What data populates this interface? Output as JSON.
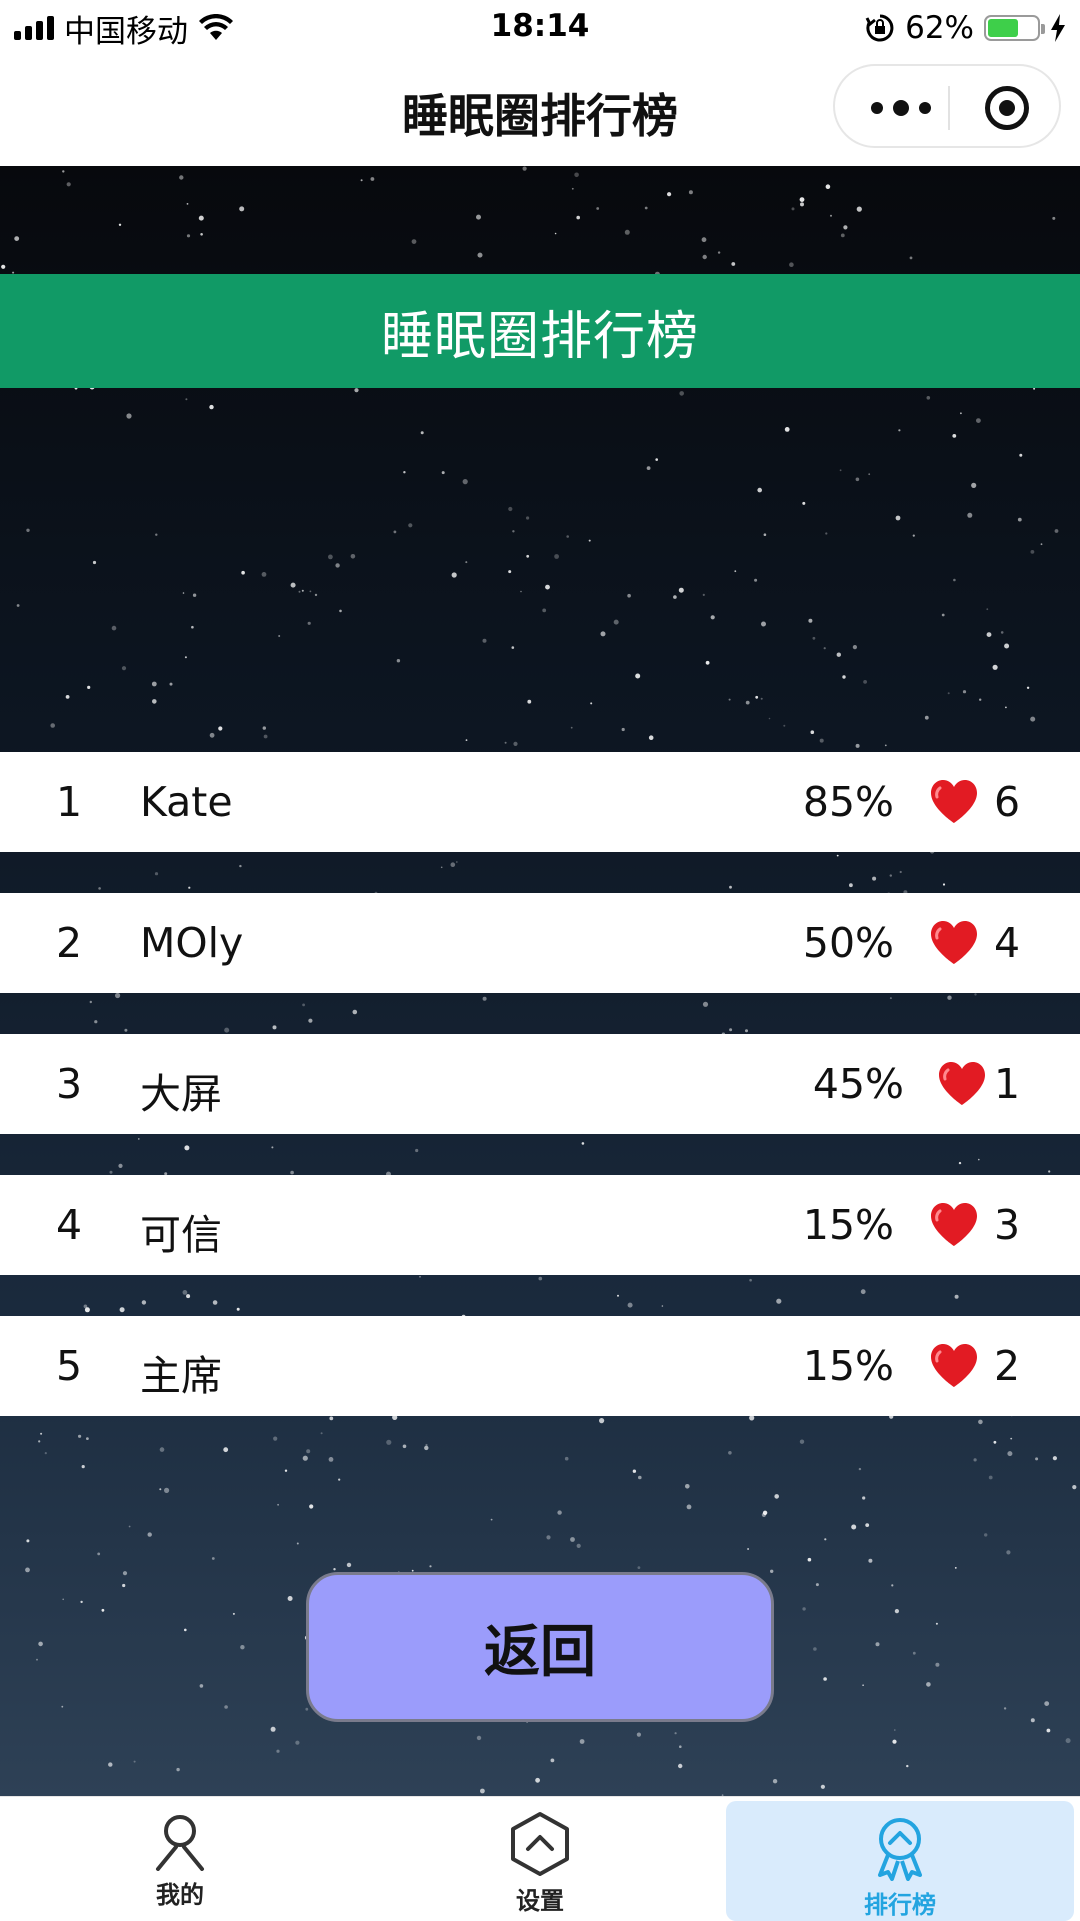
{
  "status_bar": {
    "carrier": "中国移动",
    "time": "18:14",
    "battery_percent": "62%",
    "battery_level": 0.62
  },
  "nav": {
    "title": "睡眠圈排行榜"
  },
  "banner": {
    "title": "睡眠圈排行榜"
  },
  "rankings": [
    {
      "rank": "1",
      "name": "Kate",
      "percent": "85%",
      "likes": "6"
    },
    {
      "rank": "2",
      "name": "MOly",
      "percent": "50%",
      "likes": "4"
    },
    {
      "rank": "3",
      "name": "大屏",
      "percent": "45%",
      "likes": "1"
    },
    {
      "rank": "4",
      "name": "可信",
      "percent": "15%",
      "likes": "3"
    },
    {
      "rank": "5",
      "name": "主席",
      "percent": "15%",
      "likes": "2"
    }
  ],
  "back_button": {
    "label": "返回"
  },
  "tab_bar": {
    "tabs": [
      {
        "label": "我的",
        "icon": "person-icon"
      },
      {
        "label": "设置",
        "icon": "chevron-up-hexagon-icon"
      },
      {
        "label": "排行榜",
        "icon": "medal-icon",
        "active": true
      }
    ]
  },
  "colors": {
    "banner": "#119a66",
    "back_button": "#9b9cfb",
    "active_tab": "#23a4e0",
    "heart": "#e21b23"
  }
}
